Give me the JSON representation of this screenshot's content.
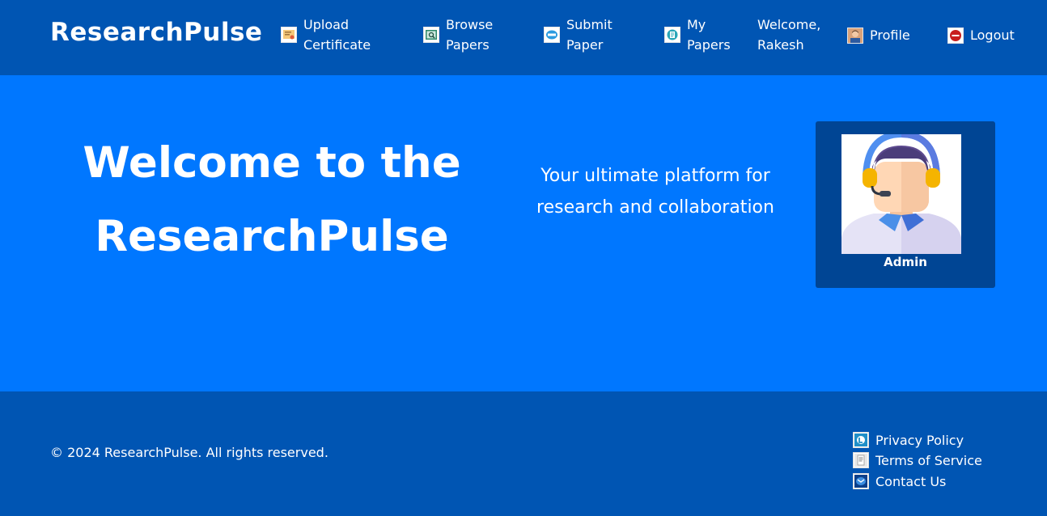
{
  "brand": "ResearchPulse",
  "nav": {
    "upload": {
      "line1": "Upload",
      "line2": "Certificate",
      "icon": "certificate-icon"
    },
    "browse": {
      "line1": "Browse",
      "line2": "Papers",
      "icon": "browse-papers-icon"
    },
    "submit": {
      "line1": "Submit",
      "line2": "Paper",
      "icon": "submit-paper-icon"
    },
    "my_papers": {
      "line1": "My",
      "line2": "Papers",
      "icon": "my-papers-icon"
    },
    "welcome": {
      "line1": "Welcome,",
      "line2": "Rakesh"
    },
    "profile": {
      "label": "Profile",
      "icon": "profile-avatar-icon"
    },
    "logout": {
      "label": "Logout",
      "icon": "logout-icon"
    }
  },
  "hero": {
    "title_line1": "Welcome to the",
    "title_line2": "ResearchPulse",
    "subtitle_line1": "Your ultimate platform for",
    "subtitle_line2": "research and collaboration"
  },
  "admin_card": {
    "name": "Admin",
    "image": "support-agent-avatar"
  },
  "footer": {
    "copyright": "© 2024 ResearchPulse. All rights reserved.",
    "links": [
      {
        "label": "Privacy Policy",
        "icon": "privacy-icon"
      },
      {
        "label": "Terms of Service",
        "icon": "terms-icon"
      },
      {
        "label": "Contact Us",
        "icon": "contact-icon"
      }
    ]
  },
  "colors": {
    "navbar_bg": "#0055b3",
    "hero_bg": "#0077ff",
    "card_bg": "#004594",
    "text": "#ffffff"
  }
}
